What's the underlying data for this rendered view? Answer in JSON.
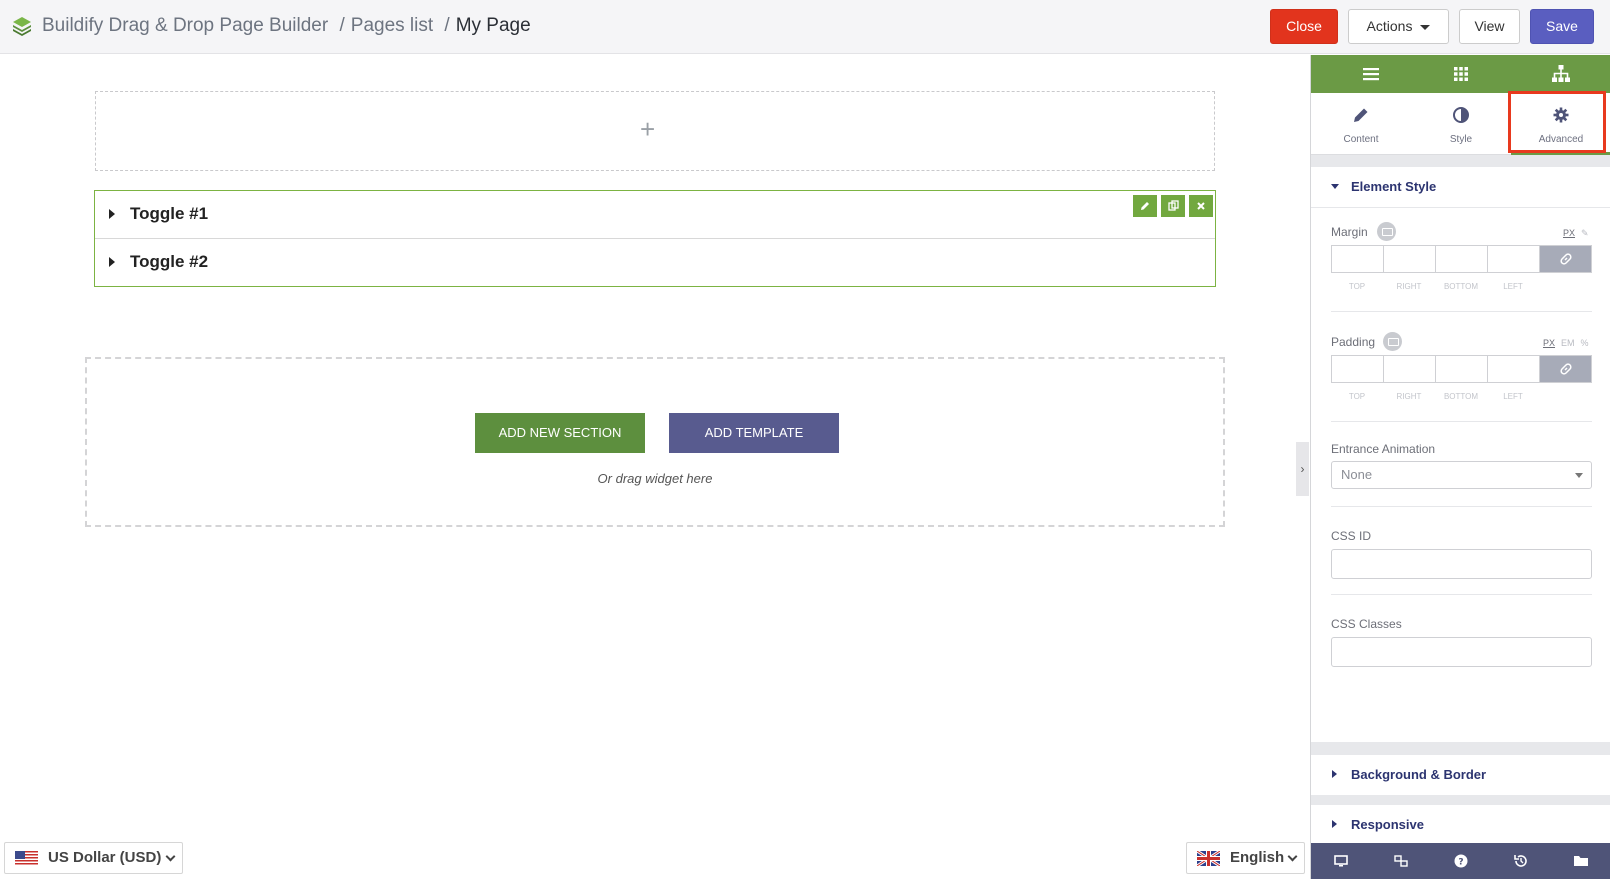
{
  "header": {
    "app_title": "Buildify Drag & Drop Page Builder",
    "crumb_sep": "/",
    "pages_list": "Pages list",
    "current_page": "My Page",
    "close_label": "Close",
    "actions_label": "Actions",
    "view_label": "View",
    "save_label": "Save",
    "close_color": "#e2341d",
    "save_color": "#5a5ec0"
  },
  "canvas": {
    "toggles": [
      {
        "title": "Toggle #1"
      },
      {
        "title": "Toggle #2"
      }
    ],
    "add_section_label": "ADD NEW SECTION",
    "add_template_label": "ADD TEMPLATE",
    "drag_hint": "Or drag widget here",
    "widget_accent": "#7cb342"
  },
  "panel": {
    "tabs": [
      {
        "label": "Content",
        "icon": "pencil-icon"
      },
      {
        "label": "Style",
        "icon": "contrast-icon"
      },
      {
        "label": "Advanced",
        "icon": "gear-icon"
      }
    ],
    "active_tab": "Advanced",
    "element_style": {
      "title": "Element Style",
      "margin": {
        "label": "Margin",
        "units": [
          "PX"
        ],
        "active_unit": "PX",
        "sides": [
          "TOP",
          "RIGHT",
          "BOTTOM",
          "LEFT"
        ]
      },
      "padding": {
        "label": "Padding",
        "units": [
          "PX",
          "EM",
          "%"
        ],
        "active_unit": "PX",
        "sides": [
          "TOP",
          "RIGHT",
          "BOTTOM",
          "LEFT"
        ]
      },
      "entrance_animation": {
        "label": "Entrance Animation",
        "value": "None"
      },
      "css_id": {
        "label": "CSS ID",
        "value": ""
      },
      "css_classes": {
        "label": "CSS Classes",
        "value": ""
      }
    },
    "background_border": {
      "title": "Background & Border"
    },
    "responsive": {
      "title": "Responsive"
    },
    "accent_color": "#6b9a45",
    "footer_color": "#4f5478"
  },
  "footer": {
    "currency": "US Dollar (USD)",
    "language": "English"
  }
}
